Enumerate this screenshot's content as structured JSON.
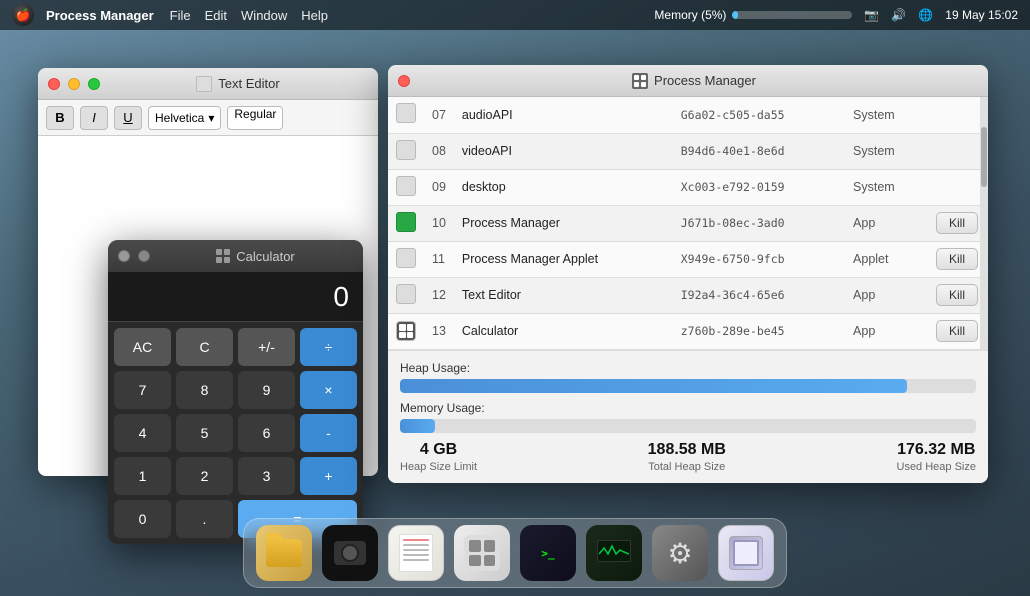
{
  "menubar": {
    "app_name": "Process Manager",
    "menus": [
      "File",
      "Edit",
      "Window",
      "Help"
    ],
    "memory_label": "Memory (5%)",
    "memory_pct": 5,
    "datetime": "19 May  15:02"
  },
  "text_editor": {
    "title": "Text Editor",
    "toolbar": {
      "bold": "B",
      "italic": "I",
      "underline": "U",
      "font": "Helvetica",
      "weight": "Regular"
    }
  },
  "calculator": {
    "title": "Calculator",
    "display": "0",
    "buttons": [
      [
        "AC",
        "C",
        "+/-",
        "÷"
      ],
      [
        "7",
        "8",
        "9",
        "×"
      ],
      [
        "4",
        "5",
        "6",
        "-"
      ],
      [
        "1",
        "2",
        "3",
        "+"
      ],
      [
        "0",
        ".",
        "=",
        ""
      ]
    ]
  },
  "process_manager": {
    "title": "Process Manager",
    "processes": [
      {
        "num": "07",
        "name": "audioAPI",
        "uuid": "G6a02-c505-da55",
        "type": "System",
        "killable": false
      },
      {
        "num": "08",
        "name": "videoAPI",
        "uuid": "B94d6-40e1-8e6d",
        "type": "System",
        "killable": false
      },
      {
        "num": "09",
        "name": "desktop",
        "uuid": "Xc003-e792-0159",
        "type": "System",
        "killable": false
      },
      {
        "num": "10",
        "name": "Process Manager",
        "uuid": "J671b-08ec-3ad0",
        "type": "App",
        "killable": true
      },
      {
        "num": "11",
        "name": "Process Manager Applet",
        "uuid": "X949e-6750-9fcb",
        "type": "Applet",
        "killable": true
      },
      {
        "num": "12",
        "name": "Text Editor",
        "uuid": "I92a4-36c4-65e6",
        "type": "App",
        "killable": true
      },
      {
        "num": "13",
        "name": "Calculator",
        "uuid": "z760b-289e-be45",
        "type": "App",
        "killable": true
      }
    ],
    "kill_label": "Kill",
    "heap_usage_label": "Heap Usage:",
    "memory_usage_label": "Memory Usage:",
    "heap_pct": 88,
    "memory_pct": 6,
    "stats": [
      {
        "value": "4 GB",
        "label": "Heap Size Limit"
      },
      {
        "value": "188.58 MB",
        "label": "Total Heap Size"
      },
      {
        "value": "176.32 MB",
        "label": "Used Heap Size"
      }
    ]
  },
  "dock": {
    "items": [
      {
        "name": "folder",
        "label": "Folder"
      },
      {
        "name": "camera",
        "label": "Camera"
      },
      {
        "name": "notepad",
        "label": "Text Editor"
      },
      {
        "name": "calc",
        "label": "Calculator"
      },
      {
        "name": "terminal",
        "label": "Terminal"
      },
      {
        "name": "monitor",
        "label": "System Monitor"
      },
      {
        "name": "gear",
        "label": "Settings"
      },
      {
        "name": "browser",
        "label": "Browser"
      }
    ]
  }
}
